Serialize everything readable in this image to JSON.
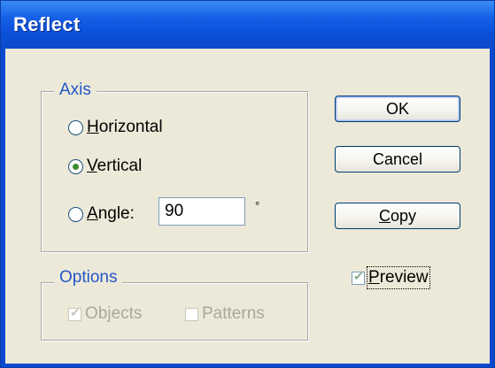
{
  "window": {
    "title": "Reflect"
  },
  "axis": {
    "legend": "Axis",
    "options": [
      {
        "label_prefix": "",
        "label_underlined": "H",
        "label_suffix": "orizontal",
        "selected": false
      },
      {
        "label_prefix": "",
        "label_underlined": "V",
        "label_suffix": "ertical",
        "selected": true
      },
      {
        "label_prefix": "",
        "label_underlined": "A",
        "label_suffix": "ngle:",
        "selected": false
      }
    ],
    "angle_value": "90",
    "angle_unit": "°"
  },
  "options_group": {
    "legend": "Options",
    "objects_label": "Objects",
    "objects_checked": true,
    "patterns_label": "Patterns",
    "patterns_checked": false
  },
  "buttons": {
    "ok": "OK",
    "cancel": "Cancel",
    "copy_underlined": "C",
    "copy_rest": "opy"
  },
  "preview": {
    "label_underlined": "P",
    "label_rest": "review",
    "checked": true
  },
  "colors": {
    "titlebar": "#0a4ed8",
    "dialog_bg": "#ece9d8",
    "legend_text": "#2456c8",
    "check_green": "#21a121"
  }
}
